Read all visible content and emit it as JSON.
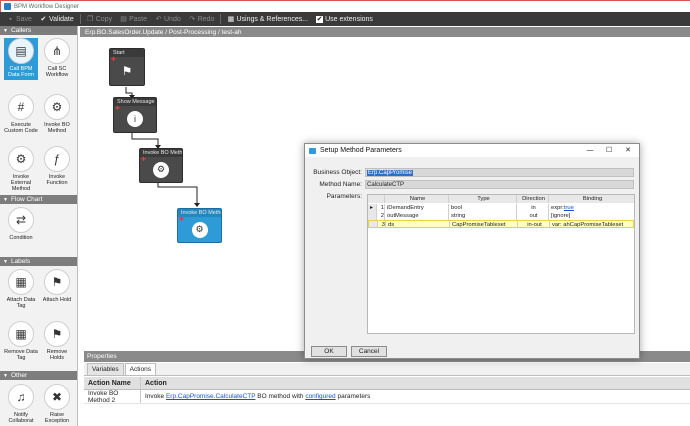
{
  "window": {
    "title": "BPM Workflow Designer"
  },
  "toolbar": {
    "save": "Save",
    "validate": "Validate",
    "copy": "Copy",
    "paste": "Paste",
    "undo": "Undo",
    "redo": "Redo",
    "usings": "Usings & References...",
    "use_extensions": "Use extensions"
  },
  "palette": {
    "callers": {
      "header": "Callers",
      "items": [
        "Call BPM Data Form",
        "Call SC Workflow",
        "Execute Custom Code",
        "Invoke BO Method",
        "Invoke External Method",
        "Invoke Function"
      ]
    },
    "flowchart": {
      "header": "Flow Chart",
      "items": [
        "Condition"
      ]
    },
    "labels": {
      "header": "Labels",
      "items": [
        "Attach Data Tag",
        "Attach Hold",
        "Remove Data Tag",
        "Remove Holds"
      ]
    },
    "other": {
      "header": "Other",
      "items": [
        "Notify Collaborat",
        "Raise Exception"
      ]
    }
  },
  "breadcrumb": "Erp.BO.SalesOrder.Update / Post-Processing / test-ah",
  "nodes": {
    "start": "Start",
    "show_message": "Show Message 0",
    "invoke1": "Invoke BO Method",
    "invoke2": "Invoke BO Method"
  },
  "dialog": {
    "title": "Setup Method Parameters",
    "business_object_label": "Business Object:",
    "business_object_value": "Erp.CapPromise",
    "method_name_label": "Method Name:",
    "method_name_value": "CalculateCTP",
    "parameters_label": "Parameters:",
    "columns": [
      "Name",
      "Type",
      "Direction",
      "Binding"
    ],
    "rows": [
      {
        "num": "1",
        "name": "iDemandEntry",
        "type": "bool",
        "direction": "in",
        "binding_prefix": "expr:",
        "binding_link": "true"
      },
      {
        "num": "2",
        "name": "outMessage",
        "type": "string",
        "direction": "out",
        "binding_prefix": "[ignore]",
        "binding_link": ""
      },
      {
        "num": "3",
        "name": "ds",
        "type": "CapPromiseTableset",
        "direction": "in-out",
        "binding_prefix": "var: ahCapPromiseTableset",
        "binding_link": ""
      }
    ],
    "ok": "OK",
    "cancel": "Cancel"
  },
  "properties": {
    "header": "Properties",
    "tabs": [
      "Variables",
      "Actions"
    ],
    "col_action_name": "Action Name",
    "col_action": "Action",
    "row": {
      "name": "Invoke BO Method 2",
      "text_pre": "Invoke ",
      "link1": "Erp.CapPromise.CalculateCTP",
      "text_mid": " BO method with ",
      "link2": "configured",
      "text_post": " parameters"
    }
  }
}
